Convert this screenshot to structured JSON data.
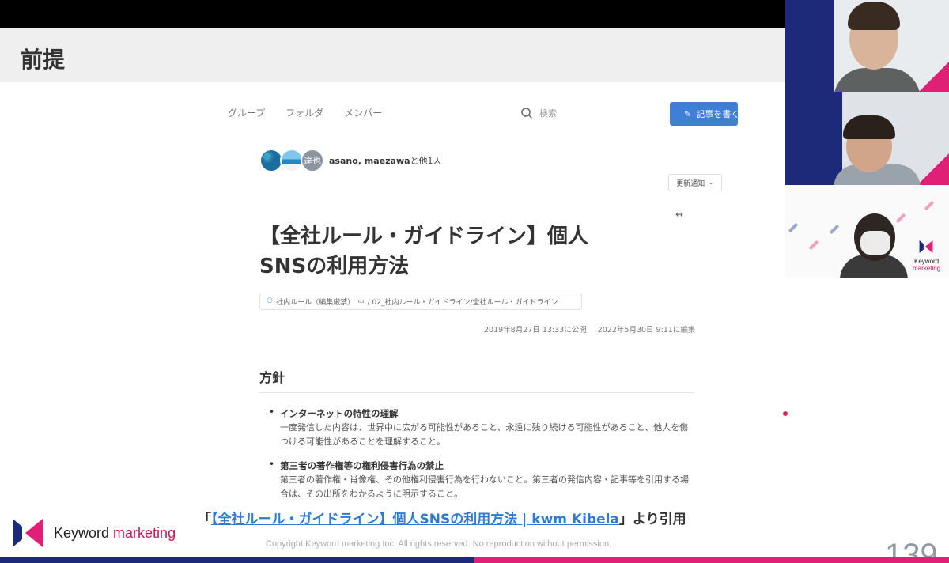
{
  "slide": {
    "title": "前提",
    "citation_prefix": "「",
    "citation_link": "【全社ルール・ガイドライン】個人SNSの利用方法 | kwm Kibela",
    "citation_suffix": "」より引用",
    "copyright": "Copyright Keyword marketing Inc. All rights reserved. No reproduction without permission.",
    "page_number": "139",
    "logo_word1": "Keyword",
    "logo_word2": "marketing"
  },
  "kibela": {
    "nav": [
      "グループ",
      "フォルダ",
      "メンバー"
    ],
    "search_placeholder": "検索",
    "write_button": "記事を書く",
    "avatar3_label": "達也",
    "authors": "asano, maezawa",
    "authors_suffix": "と他1人",
    "notify_button": "更新通知",
    "expand_icon": "↔",
    "title_line1": "【全社ルール・ガイドライン】個人",
    "title_line2": "SNSの利用方法",
    "path_group": "社内ルール（編集厳禁）",
    "path_folder": "/ 02_社内ルール・ガイドライン/全社ルール・ガイドライン",
    "published": "2019年8月27日 13:33に公開",
    "edited": "2022年5月30日 9:11に編集",
    "section": "方針",
    "items": [
      {
        "heading": "インターネットの特性の理解",
        "body": "一度発信した内容は、世界中に広がる可能性があること、永遠に残り続ける可能性があること、他人を傷つける可能性があることを理解すること。"
      },
      {
        "heading": "第三者の著作権等の権利侵害行為の禁止",
        "body": "第三者の著作権・肖像権、その他権利侵害行為を行わないこと。第三者の発信内容・記事等を引用する場合は、その出所をわかるように明示すること。"
      }
    ]
  },
  "webcam": {
    "logo_word1": "Keyword",
    "logo_word2": "marketing"
  },
  "colors": {
    "brand_navy": "#1d2a7a",
    "brand_pink": "#e01f76",
    "link_blue": "#2e7bd3",
    "button_blue": "#3f7fd6"
  }
}
